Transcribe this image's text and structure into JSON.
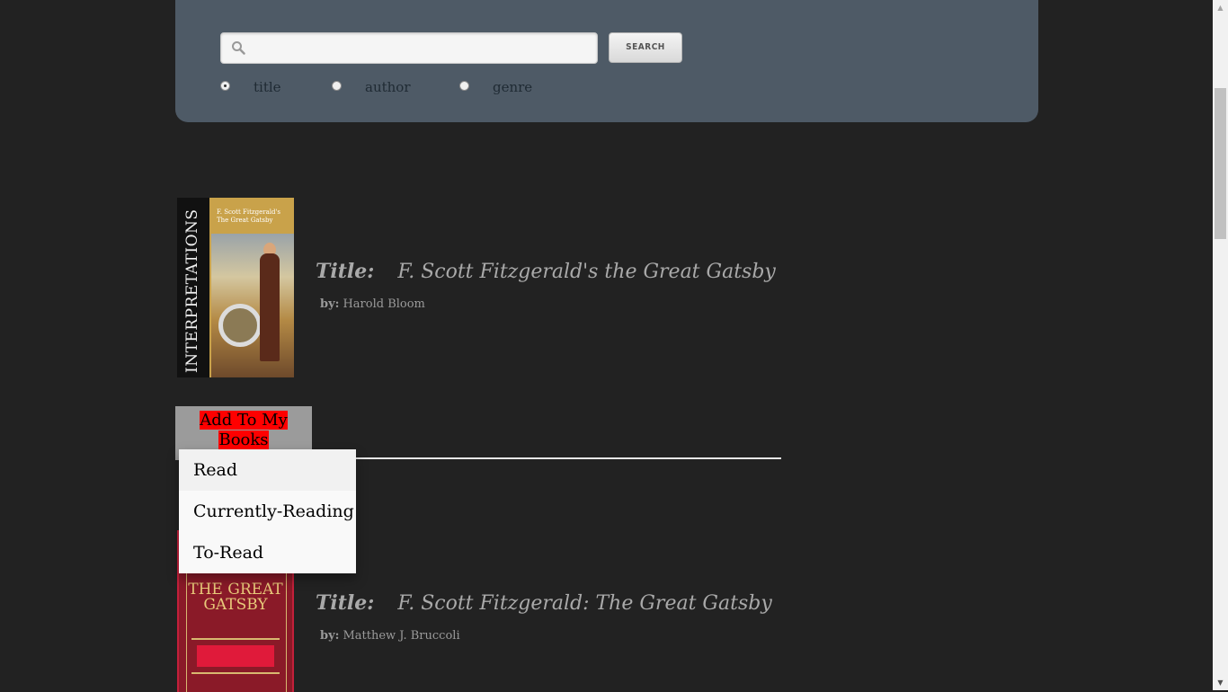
{
  "search": {
    "placeholder": "",
    "button_label": "SEARCH",
    "options": [
      {
        "label": "title",
        "checked": true
      },
      {
        "label": "author",
        "checked": false
      },
      {
        "label": "genre",
        "checked": false
      }
    ]
  },
  "books": [
    {
      "title_label": "Title:",
      "title": "F. Scott Fitzgerald's the Great Gatsby",
      "by_label": "by:",
      "author": "Harold Bloom",
      "cover_text": {
        "spine": "INTERPRETATIONS",
        "top": "F. Scott Fitzgerald's The Great Gatsby"
      }
    },
    {
      "title_label": "Title:",
      "title": "F. Scott Fitzgerald: The Great Gatsby",
      "by_label": "by:",
      "author": "Matthew J. Bruccoli",
      "cover_text": {
        "art": "THE GREAT GATSBY"
      }
    }
  ],
  "add_to_books": {
    "label": "Add To My Books",
    "menu": [
      "Read",
      "Currently-Reading",
      "To-Read"
    ]
  },
  "colors": {
    "background": "#222222",
    "panel": "#4e5a66",
    "add_button_highlight": "#ff0000"
  }
}
